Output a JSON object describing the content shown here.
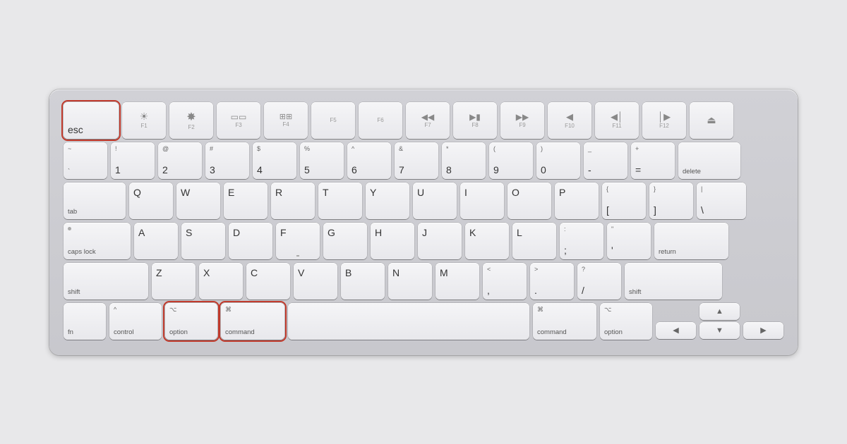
{
  "keyboard": {
    "rows": {
      "fn_row": [
        {
          "id": "esc",
          "label": "esc",
          "width": "esc",
          "highlighted": true
        },
        {
          "id": "f1",
          "label": "F1",
          "icon": "☀",
          "width": "fn-key"
        },
        {
          "id": "f2",
          "label": "F2",
          "icon": "☀",
          "width": "fn-key"
        },
        {
          "id": "f3",
          "label": "F3",
          "icon": "⊞",
          "width": "fn-key"
        },
        {
          "id": "f4",
          "label": "F4",
          "icon": "⊞⊞",
          "width": "fn-key"
        },
        {
          "id": "f5",
          "label": "F5",
          "width": "fn-key"
        },
        {
          "id": "f6",
          "label": "F6",
          "width": "fn-key"
        },
        {
          "id": "f7",
          "label": "F7",
          "icon": "◀◀",
          "width": "fn-key"
        },
        {
          "id": "f8",
          "label": "F8",
          "icon": "▶‖",
          "width": "fn-key"
        },
        {
          "id": "f9",
          "label": "F9",
          "icon": "▶▶",
          "width": "fn-key"
        },
        {
          "id": "f10",
          "label": "F10",
          "icon": "🔇",
          "width": "fn-key"
        },
        {
          "id": "f11",
          "label": "F11",
          "icon": "🔉",
          "width": "fn-key"
        },
        {
          "id": "f12",
          "label": "F12",
          "icon": "🔊",
          "width": "fn-key"
        },
        {
          "id": "eject",
          "label": "",
          "icon": "⏏",
          "width": "eject"
        }
      ],
      "number_row": [
        {
          "id": "backtick",
          "top": "~",
          "label": "`",
          "width": "std"
        },
        {
          "id": "1",
          "top": "!",
          "label": "1",
          "width": "std"
        },
        {
          "id": "2",
          "top": "@",
          "label": "2",
          "width": "std"
        },
        {
          "id": "3",
          "top": "#",
          "label": "3",
          "width": "std"
        },
        {
          "id": "4",
          "top": "$",
          "label": "4",
          "width": "std"
        },
        {
          "id": "5",
          "top": "%",
          "label": "5",
          "width": "std"
        },
        {
          "id": "6",
          "top": "^",
          "label": "6",
          "width": "std"
        },
        {
          "id": "7",
          "top": "&",
          "label": "7",
          "width": "std"
        },
        {
          "id": "8",
          "top": "*",
          "label": "8",
          "width": "std"
        },
        {
          "id": "9",
          "top": "(",
          "label": "9",
          "width": "std"
        },
        {
          "id": "0",
          "top": ")",
          "label": "0",
          "width": "std"
        },
        {
          "id": "minus",
          "top": "_",
          "label": "-",
          "width": "std"
        },
        {
          "id": "equals",
          "top": "+",
          "label": "=",
          "width": "std"
        },
        {
          "id": "delete",
          "label": "delete",
          "width": "delete"
        }
      ],
      "qwerty_row": [
        {
          "id": "tab",
          "label": "tab",
          "width": "tab"
        },
        {
          "id": "q",
          "label": "Q",
          "width": "std"
        },
        {
          "id": "w",
          "label": "W",
          "width": "std"
        },
        {
          "id": "e",
          "label": "E",
          "width": "std"
        },
        {
          "id": "r",
          "label": "R",
          "width": "std"
        },
        {
          "id": "t",
          "label": "T",
          "width": "std"
        },
        {
          "id": "y",
          "label": "Y",
          "width": "std"
        },
        {
          "id": "u",
          "label": "U",
          "width": "std"
        },
        {
          "id": "i",
          "label": "I",
          "width": "std"
        },
        {
          "id": "o",
          "label": "O",
          "width": "std"
        },
        {
          "id": "p",
          "label": "P",
          "width": "std"
        },
        {
          "id": "lbracket",
          "top": "{",
          "label": "[",
          "width": "std"
        },
        {
          "id": "rbracket",
          "top": "}",
          "label": "]",
          "width": "std"
        },
        {
          "id": "backslash",
          "top": "|",
          "label": "\\",
          "width": "backslash"
        }
      ],
      "asdf_row": [
        {
          "id": "capslock",
          "label": "caps lock",
          "dot": true,
          "width": "capslock"
        },
        {
          "id": "a",
          "label": "A",
          "width": "std"
        },
        {
          "id": "s",
          "label": "S",
          "width": "std"
        },
        {
          "id": "d",
          "label": "D",
          "width": "std"
        },
        {
          "id": "f",
          "label": "F",
          "width": "std"
        },
        {
          "id": "g",
          "label": "G",
          "width": "std"
        },
        {
          "id": "h",
          "label": "H",
          "width": "std"
        },
        {
          "id": "j",
          "label": "J",
          "width": "std"
        },
        {
          "id": "k",
          "label": "K",
          "width": "std"
        },
        {
          "id": "l",
          "label": "L",
          "width": "std"
        },
        {
          "id": "semicolon",
          "top": ":",
          "label": ";",
          "width": "std"
        },
        {
          "id": "quote",
          "top": "\"",
          "label": "'",
          "width": "std"
        },
        {
          "id": "return",
          "label": "return",
          "width": "return"
        }
      ],
      "zxcv_row": [
        {
          "id": "shift-l",
          "label": "shift",
          "width": "shift-l"
        },
        {
          "id": "z",
          "label": "Z",
          "width": "std"
        },
        {
          "id": "x",
          "label": "X",
          "width": "std"
        },
        {
          "id": "c",
          "label": "C",
          "width": "std"
        },
        {
          "id": "v",
          "label": "V",
          "width": "std"
        },
        {
          "id": "b",
          "label": "B",
          "width": "std"
        },
        {
          "id": "n",
          "label": "N",
          "width": "std"
        },
        {
          "id": "m",
          "label": "M",
          "width": "std"
        },
        {
          "id": "comma",
          "top": "<",
          "label": ",",
          "width": "std"
        },
        {
          "id": "period",
          "top": ">",
          "label": ".",
          "width": "std"
        },
        {
          "id": "slash",
          "top": "?",
          "label": "/",
          "width": "std"
        },
        {
          "id": "shift-r",
          "label": "shift",
          "width": "shift-r"
        }
      ],
      "bottom_row": [
        {
          "id": "fn",
          "label": "fn",
          "width": "fn"
        },
        {
          "id": "control",
          "label": "control",
          "icon": "^",
          "width": "control"
        },
        {
          "id": "option-l",
          "label": "option",
          "icon": "⌥",
          "width": "option",
          "highlighted": true
        },
        {
          "id": "command-l",
          "label": "command",
          "icon": "⌘",
          "width": "command-l",
          "highlighted": true
        },
        {
          "id": "space",
          "label": "",
          "width": "space"
        },
        {
          "id": "command-r",
          "label": "command",
          "icon": "⌘",
          "width": "command-r"
        },
        {
          "id": "option-r",
          "label": "option",
          "icon": "⌥",
          "width": "option-r"
        }
      ]
    }
  }
}
